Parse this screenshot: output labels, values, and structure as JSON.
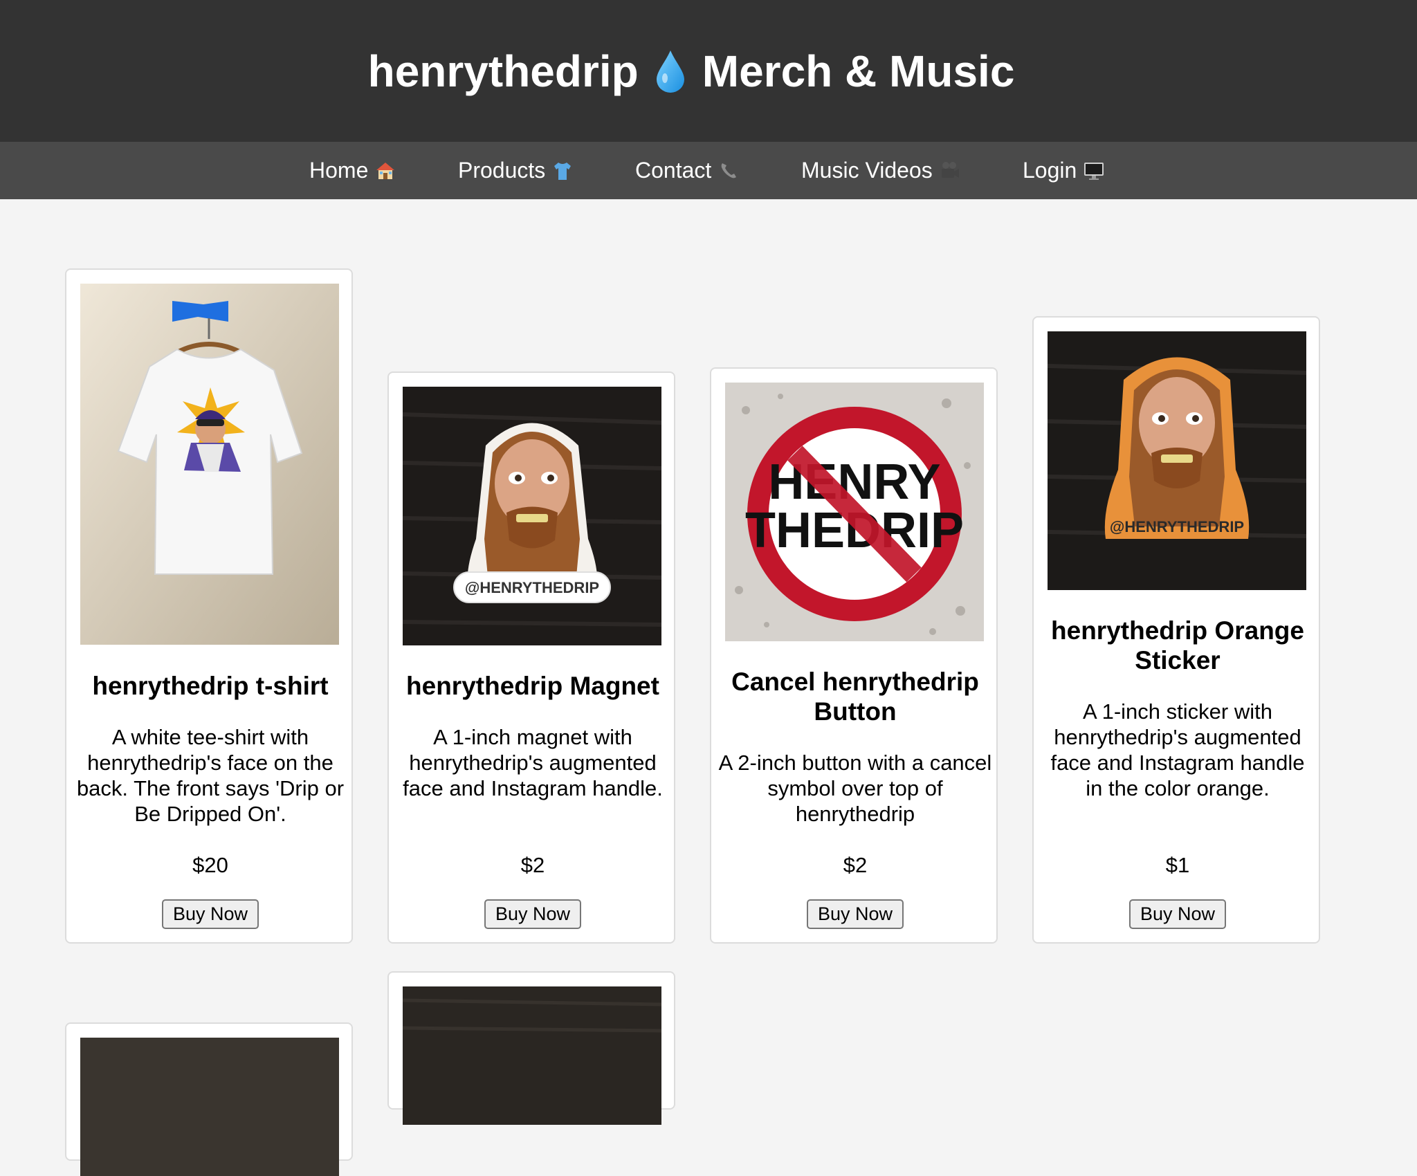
{
  "header": {
    "title_left": "henrythedrip",
    "title_icon": "droplet-icon",
    "title_right": "Merch & Music"
  },
  "nav": {
    "items": [
      {
        "label": "Home",
        "icon": "house-icon"
      },
      {
        "label": "Products",
        "icon": "tshirt-icon"
      },
      {
        "label": "Contact",
        "icon": "telephone-icon"
      },
      {
        "label": "Music Videos",
        "icon": "film-camera-icon"
      },
      {
        "label": "Login",
        "icon": "computer-icon"
      }
    ]
  },
  "products": [
    {
      "title": "henrythedrip t-shirt",
      "description": "A white tee-shirt with henrythedrip's face on the back. The front says 'Drip or Be Dripped On'.",
      "price": "$20",
      "button": "Buy Now"
    },
    {
      "title": "henrythedrip Magnet",
      "description": "A 1-inch magnet with henrythedrip's augmented face and Instagram handle.",
      "price": "$2",
      "button": "Buy Now",
      "image_text": "@HENRYTHEDRIP"
    },
    {
      "title": "Cancel henrythedrip Button",
      "description": "A 2-inch button with a cancel symbol over top of henrythedrip",
      "price": "$2",
      "button": "Buy Now",
      "image_text_line1": "HENRY",
      "image_text_line2": "THEDRIP"
    },
    {
      "title": "henrythedrip Orange Sticker",
      "description": "A 1-inch sticker with henrythedrip's augmented face and Instagram handle in the color orange.",
      "price": "$1",
      "button": "Buy Now",
      "image_text": "@HENRYTHEDRIP"
    }
  ],
  "colors": {
    "header_bg": "#333333",
    "nav_bg": "#4a4a4a",
    "page_bg": "#f4f4f4"
  }
}
